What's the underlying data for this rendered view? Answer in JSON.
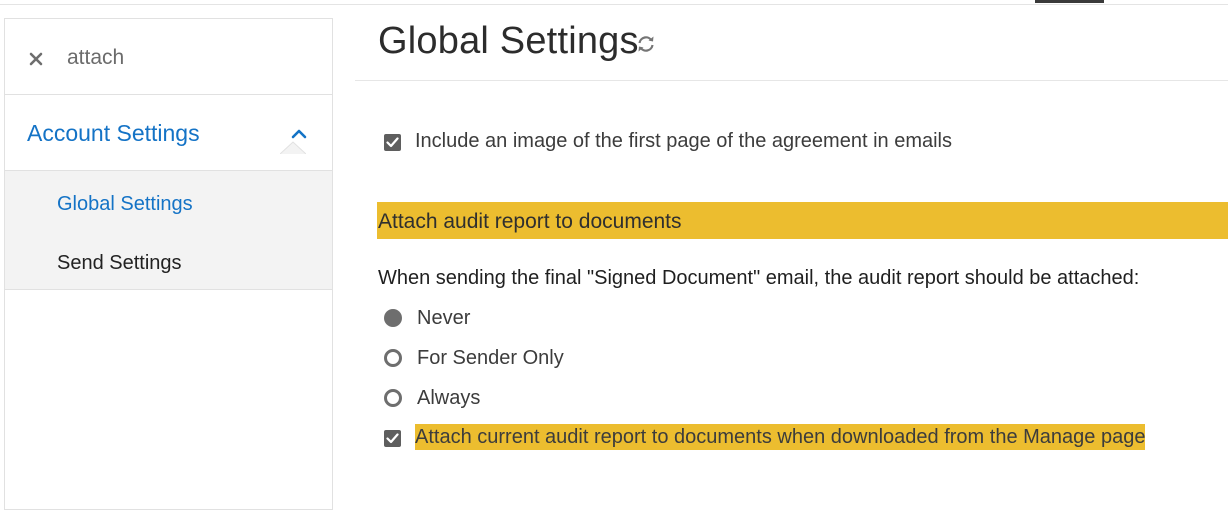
{
  "search": {
    "value": "attach"
  },
  "sidebar": {
    "section_label": "Account Settings",
    "items": [
      {
        "label": "Global Settings",
        "active": true
      },
      {
        "label": "Send Settings",
        "active": false
      }
    ]
  },
  "main": {
    "title": "Global Settings",
    "options": {
      "include_image": {
        "label": "Include an image of the first page of the agreement in emails",
        "checked": true
      }
    },
    "audit_section": {
      "title": "Attach audit report to documents",
      "question": "When sending the final \"Signed Document\" email, the audit report should be attached:",
      "radios": [
        {
          "label": "Never",
          "selected": true
        },
        {
          "label": "For Sender Only",
          "selected": false
        },
        {
          "label": "Always",
          "selected": false
        }
      ],
      "download_option": {
        "label": "Attach current audit report to documents when downloaded from the Manage page",
        "checked": true
      }
    }
  },
  "colors": {
    "accent": "#1473c6",
    "highlight": "#ecbd2f",
    "control": "#5e5e5e"
  },
  "icons": {
    "clear": "close-icon",
    "chevron": "chevron-up-icon",
    "refresh": "refresh-icon",
    "check": "checkmark-icon"
  }
}
